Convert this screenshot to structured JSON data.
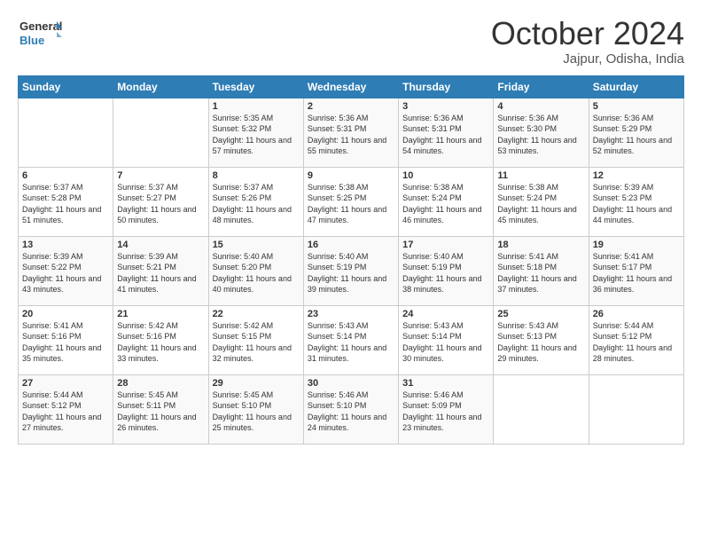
{
  "logo": {
    "line1": "General",
    "line2": "Blue"
  },
  "title": "October 2024",
  "location": "Jajpur, Odisha, India",
  "weekdays": [
    "Sunday",
    "Monday",
    "Tuesday",
    "Wednesday",
    "Thursday",
    "Friday",
    "Saturday"
  ],
  "weeks": [
    [
      {
        "day": "",
        "sunrise": "",
        "sunset": "",
        "daylight": ""
      },
      {
        "day": "",
        "sunrise": "",
        "sunset": "",
        "daylight": ""
      },
      {
        "day": "1",
        "sunrise": "Sunrise: 5:35 AM",
        "sunset": "Sunset: 5:32 PM",
        "daylight": "Daylight: 11 hours and 57 minutes."
      },
      {
        "day": "2",
        "sunrise": "Sunrise: 5:36 AM",
        "sunset": "Sunset: 5:31 PM",
        "daylight": "Daylight: 11 hours and 55 minutes."
      },
      {
        "day": "3",
        "sunrise": "Sunrise: 5:36 AM",
        "sunset": "Sunset: 5:31 PM",
        "daylight": "Daylight: 11 hours and 54 minutes."
      },
      {
        "day": "4",
        "sunrise": "Sunrise: 5:36 AM",
        "sunset": "Sunset: 5:30 PM",
        "daylight": "Daylight: 11 hours and 53 minutes."
      },
      {
        "day": "5",
        "sunrise": "Sunrise: 5:36 AM",
        "sunset": "Sunset: 5:29 PM",
        "daylight": "Daylight: 11 hours and 52 minutes."
      }
    ],
    [
      {
        "day": "6",
        "sunrise": "Sunrise: 5:37 AM",
        "sunset": "Sunset: 5:28 PM",
        "daylight": "Daylight: 11 hours and 51 minutes."
      },
      {
        "day": "7",
        "sunrise": "Sunrise: 5:37 AM",
        "sunset": "Sunset: 5:27 PM",
        "daylight": "Daylight: 11 hours and 50 minutes."
      },
      {
        "day": "8",
        "sunrise": "Sunrise: 5:37 AM",
        "sunset": "Sunset: 5:26 PM",
        "daylight": "Daylight: 11 hours and 48 minutes."
      },
      {
        "day": "9",
        "sunrise": "Sunrise: 5:38 AM",
        "sunset": "Sunset: 5:25 PM",
        "daylight": "Daylight: 11 hours and 47 minutes."
      },
      {
        "day": "10",
        "sunrise": "Sunrise: 5:38 AM",
        "sunset": "Sunset: 5:24 PM",
        "daylight": "Daylight: 11 hours and 46 minutes."
      },
      {
        "day": "11",
        "sunrise": "Sunrise: 5:38 AM",
        "sunset": "Sunset: 5:24 PM",
        "daylight": "Daylight: 11 hours and 45 minutes."
      },
      {
        "day": "12",
        "sunrise": "Sunrise: 5:39 AM",
        "sunset": "Sunset: 5:23 PM",
        "daylight": "Daylight: 11 hours and 44 minutes."
      }
    ],
    [
      {
        "day": "13",
        "sunrise": "Sunrise: 5:39 AM",
        "sunset": "Sunset: 5:22 PM",
        "daylight": "Daylight: 11 hours and 43 minutes."
      },
      {
        "day": "14",
        "sunrise": "Sunrise: 5:39 AM",
        "sunset": "Sunset: 5:21 PM",
        "daylight": "Daylight: 11 hours and 41 minutes."
      },
      {
        "day": "15",
        "sunrise": "Sunrise: 5:40 AM",
        "sunset": "Sunset: 5:20 PM",
        "daylight": "Daylight: 11 hours and 40 minutes."
      },
      {
        "day": "16",
        "sunrise": "Sunrise: 5:40 AM",
        "sunset": "Sunset: 5:19 PM",
        "daylight": "Daylight: 11 hours and 39 minutes."
      },
      {
        "day": "17",
        "sunrise": "Sunrise: 5:40 AM",
        "sunset": "Sunset: 5:19 PM",
        "daylight": "Daylight: 11 hours and 38 minutes."
      },
      {
        "day": "18",
        "sunrise": "Sunrise: 5:41 AM",
        "sunset": "Sunset: 5:18 PM",
        "daylight": "Daylight: 11 hours and 37 minutes."
      },
      {
        "day": "19",
        "sunrise": "Sunrise: 5:41 AM",
        "sunset": "Sunset: 5:17 PM",
        "daylight": "Daylight: 11 hours and 36 minutes."
      }
    ],
    [
      {
        "day": "20",
        "sunrise": "Sunrise: 5:41 AM",
        "sunset": "Sunset: 5:16 PM",
        "daylight": "Daylight: 11 hours and 35 minutes."
      },
      {
        "day": "21",
        "sunrise": "Sunrise: 5:42 AM",
        "sunset": "Sunset: 5:16 PM",
        "daylight": "Daylight: 11 hours and 33 minutes."
      },
      {
        "day": "22",
        "sunrise": "Sunrise: 5:42 AM",
        "sunset": "Sunset: 5:15 PM",
        "daylight": "Daylight: 11 hours and 32 minutes."
      },
      {
        "day": "23",
        "sunrise": "Sunrise: 5:43 AM",
        "sunset": "Sunset: 5:14 PM",
        "daylight": "Daylight: 11 hours and 31 minutes."
      },
      {
        "day": "24",
        "sunrise": "Sunrise: 5:43 AM",
        "sunset": "Sunset: 5:14 PM",
        "daylight": "Daylight: 11 hours and 30 minutes."
      },
      {
        "day": "25",
        "sunrise": "Sunrise: 5:43 AM",
        "sunset": "Sunset: 5:13 PM",
        "daylight": "Daylight: 11 hours and 29 minutes."
      },
      {
        "day": "26",
        "sunrise": "Sunrise: 5:44 AM",
        "sunset": "Sunset: 5:12 PM",
        "daylight": "Daylight: 11 hours and 28 minutes."
      }
    ],
    [
      {
        "day": "27",
        "sunrise": "Sunrise: 5:44 AM",
        "sunset": "Sunset: 5:12 PM",
        "daylight": "Daylight: 11 hours and 27 minutes."
      },
      {
        "day": "28",
        "sunrise": "Sunrise: 5:45 AM",
        "sunset": "Sunset: 5:11 PM",
        "daylight": "Daylight: 11 hours and 26 minutes."
      },
      {
        "day": "29",
        "sunrise": "Sunrise: 5:45 AM",
        "sunset": "Sunset: 5:10 PM",
        "daylight": "Daylight: 11 hours and 25 minutes."
      },
      {
        "day": "30",
        "sunrise": "Sunrise: 5:46 AM",
        "sunset": "Sunset: 5:10 PM",
        "daylight": "Daylight: 11 hours and 24 minutes."
      },
      {
        "day": "31",
        "sunrise": "Sunrise: 5:46 AM",
        "sunset": "Sunset: 5:09 PM",
        "daylight": "Daylight: 11 hours and 23 minutes."
      },
      {
        "day": "",
        "sunrise": "",
        "sunset": "",
        "daylight": ""
      },
      {
        "day": "",
        "sunrise": "",
        "sunset": "",
        "daylight": ""
      }
    ]
  ]
}
